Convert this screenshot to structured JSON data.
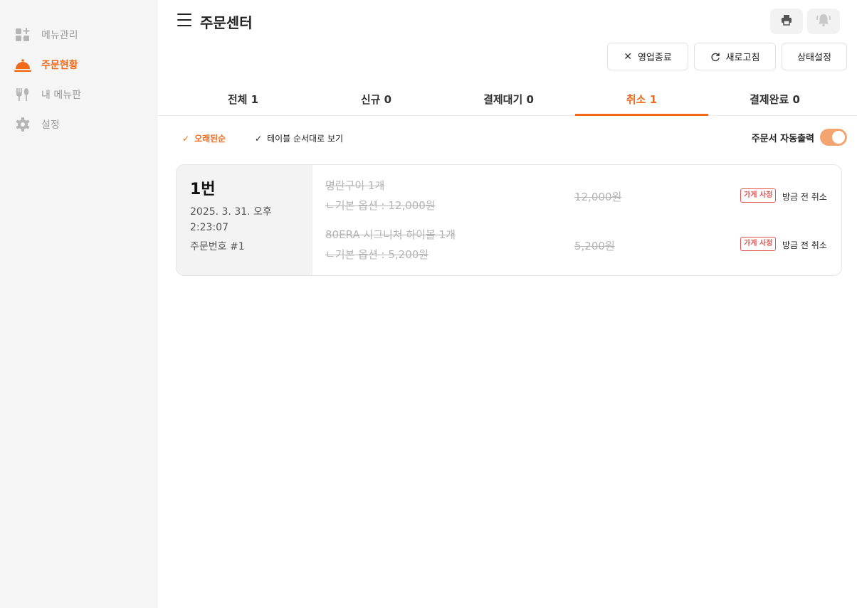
{
  "sidebar": {
    "items": [
      {
        "label": "메뉴관리",
        "icon": "menu-manage-icon"
      },
      {
        "label": "주문현황",
        "icon": "cloche-icon",
        "active": true
      },
      {
        "label": "내 메뉴판",
        "icon": "utensils-icon"
      },
      {
        "label": "설정",
        "icon": "gear-icon"
      }
    ]
  },
  "header": {
    "title": "주문센터",
    "print_icon": "printer-icon",
    "bell_icon": "bell-icon"
  },
  "toolbar": {
    "close_business": "영업종료",
    "refresh": "새로고침",
    "status_settings": "상태설정"
  },
  "tabs": [
    {
      "label": "전체 1"
    },
    {
      "label": "신규 0"
    },
    {
      "label": "결제대기 0"
    },
    {
      "label": "취소 1",
      "active": true
    },
    {
      "label": "결제완료 0"
    }
  ],
  "filters": {
    "oldest": "오래된순",
    "table_order": "테이블 순서대로 보기"
  },
  "auto_print": {
    "label": "주문서 자동출력",
    "enabled": true
  },
  "order": {
    "table": "1번",
    "date": "2025. 3. 31. 오후 2:23:07",
    "number": "주문번호 #1",
    "items": [
      {
        "name": "명란구이 1개",
        "option": "ㄴ기본 옵션 : 12,000원",
        "price": "12,000원",
        "badge": "가게 사정",
        "reason": "방금 전 취소"
      },
      {
        "name": "80ERA 시그니처 하이볼 1개",
        "option": "ㄴ기본 옵션 : 5,200원",
        "price": "5,200원",
        "badge": "가게 사정",
        "reason": "방금 전 취소"
      }
    ]
  },
  "colors": {
    "accent": "#ef6a1c",
    "cancel": "#e25555",
    "toggle_on": "#f4a46f"
  }
}
